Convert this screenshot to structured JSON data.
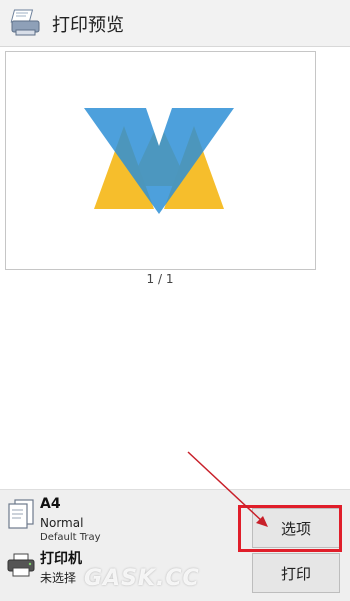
{
  "header": {
    "title": "打印预览",
    "icon": "printer-preview-icon"
  },
  "preview": {
    "page_indicator": "1 / 1",
    "logo_colors": {
      "blue": "#2E8FD6",
      "yellow": "#F6BE2C"
    }
  },
  "paper": {
    "icon": "paper-icon",
    "size": "A4",
    "type": "Normal",
    "tray": "Default Tray"
  },
  "printer": {
    "icon": "printer-icon",
    "name": "打印机",
    "status": "未选择"
  },
  "buttons": {
    "options_label": "选项",
    "print_label": "打印"
  },
  "annotation": {
    "highlight_color": "#E01E2A",
    "watermark": "GASK.CC"
  }
}
